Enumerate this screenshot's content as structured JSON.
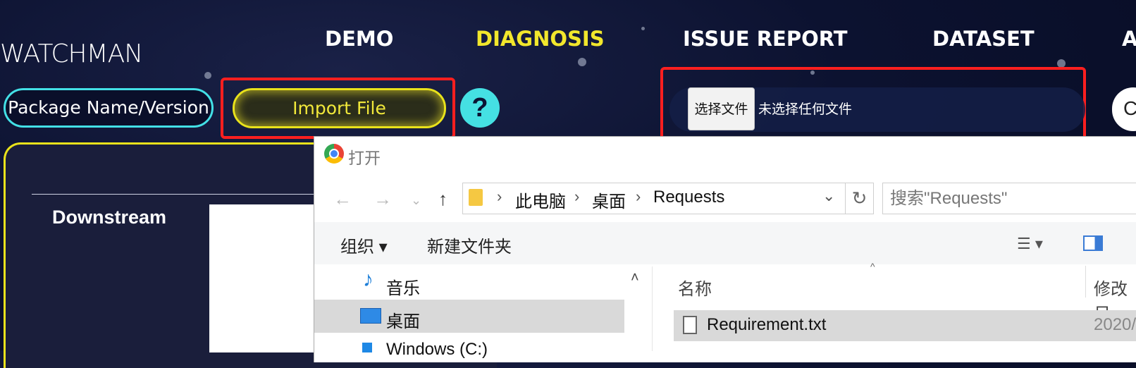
{
  "header": {
    "logo": "WATCHMAN",
    "nav": [
      "DEMO",
      "DIAGNOSIS",
      "ISSUE REPORT",
      "DATASET",
      "A"
    ],
    "active_nav": "DIAGNOSIS"
  },
  "controls": {
    "package_input": "Package Name/Version",
    "import_button": "Import File",
    "help_button": "?",
    "file_choose_button": "选择文件",
    "file_status": "未选择任何文件",
    "right_pill_text": "C"
  },
  "panel": {
    "heading": "Downstream"
  },
  "dialog": {
    "title": "打开",
    "breadcrumb": [
      "此电脑",
      "桌面",
      "Requests"
    ],
    "search_placeholder": "搜索\"Requests\"",
    "toolbar": {
      "organize": "组织 ▾",
      "new_folder": "新建文件夹"
    },
    "nav_pane": [
      {
        "label": "音乐",
        "selected": false
      },
      {
        "label": "桌面",
        "selected": true
      },
      {
        "label": "Windows (C:)",
        "selected": false
      }
    ],
    "columns": {
      "name": "名称",
      "modified": "修改日"
    },
    "files": [
      {
        "name": "Requirement.txt",
        "modified": "2020/"
      }
    ]
  },
  "colors": {
    "accent_yellow": "#f2e72c",
    "accent_cyan": "#43e0e6",
    "highlight_red": "#ff1f1f"
  }
}
